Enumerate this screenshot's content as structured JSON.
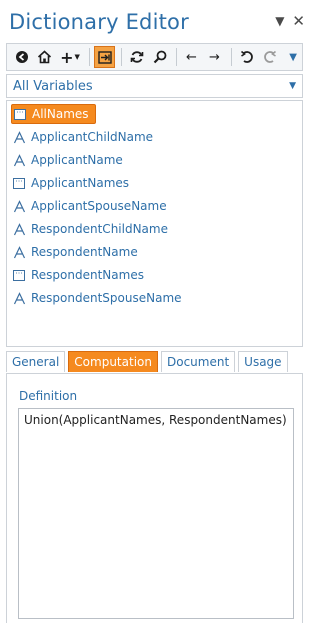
{
  "header": {
    "title": "Dictionary Editor"
  },
  "filter": {
    "selected": "All Variables"
  },
  "variables": [
    {
      "label": "AllNames",
      "icon": "list-variable-icon",
      "selected": true
    },
    {
      "label": "ApplicantChildName",
      "icon": "string-variable-icon"
    },
    {
      "label": "ApplicantName",
      "icon": "string-variable-icon"
    },
    {
      "label": "ApplicantNames",
      "icon": "list-variable-icon"
    },
    {
      "label": "ApplicantSpouseName",
      "icon": "string-variable-icon"
    },
    {
      "label": "RespondentChildName",
      "icon": "string-variable-icon"
    },
    {
      "label": "RespondentName",
      "icon": "string-variable-icon"
    },
    {
      "label": "RespondentNames",
      "icon": "list-variable-icon"
    },
    {
      "label": "RespondentSpouseName",
      "icon": "string-variable-icon"
    }
  ],
  "tabs": [
    {
      "label": "General"
    },
    {
      "label": "Computation",
      "active": true
    },
    {
      "label": "Document"
    },
    {
      "label": "Usage"
    }
  ],
  "computation": {
    "definition_label": "Definition",
    "definition_value": "Union(ApplicantNames, RespondentNames)"
  },
  "colors": {
    "accent": "#f58a1f",
    "title": "#2e6fa8"
  }
}
